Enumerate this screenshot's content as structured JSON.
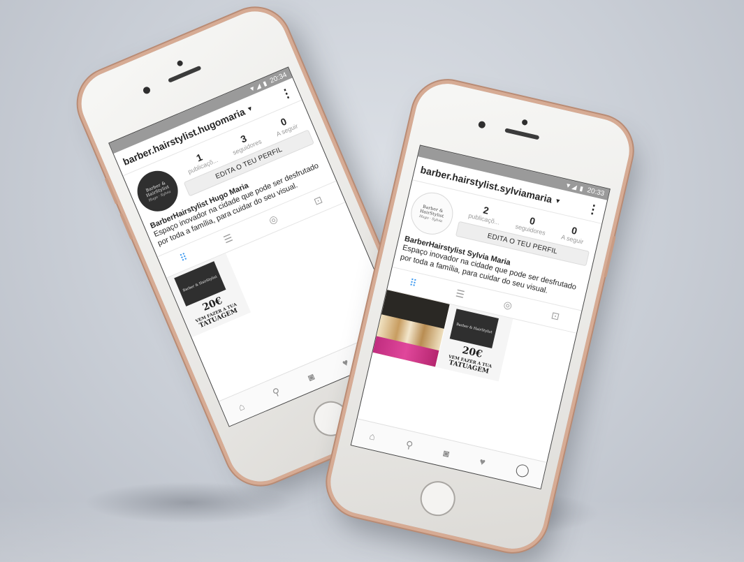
{
  "phones": [
    {
      "status": {
        "time": "20:34",
        "signal": "▼◢ ▮"
      },
      "username": "barber.hairstylist.hugomaria",
      "avatar": {
        "brand": "Barber & HairStylist",
        "sub": "Hugo · Sylvia"
      },
      "stats": [
        {
          "num": "1",
          "label": "publicaçõ..."
        },
        {
          "num": "3",
          "label": "seguidores"
        },
        {
          "num": "0",
          "label": "A seguir"
        }
      ],
      "edit_label": "EDITA O TEU PERFIL",
      "bio_name": "BarberHairstylist Hugo Maria",
      "bio_text": "Espaço inovador na cidade que pode ser desfrutado por toda a família, para cuidar do seu visual.",
      "promo": {
        "brand": "Barber & HairStylist",
        "price": "20€",
        "line1": "VEM FAZER A TUA",
        "line2": "TATUAGEM"
      }
    },
    {
      "status": {
        "time": "20:33",
        "signal": "▼◢ ▮"
      },
      "username": "barber.hairstylist.sylviamaria",
      "avatar": {
        "brand": "Barber & HairStylist",
        "sub": "Hugo · Sylvia"
      },
      "stats": [
        {
          "num": "2",
          "label": "publicaçõ..."
        },
        {
          "num": "0",
          "label": "seguidores"
        },
        {
          "num": "0",
          "label": "A seguir"
        }
      ],
      "edit_label": "EDITA O TEU PERFIL",
      "bio_name": "BarberHairstylist Sylvia Maria",
      "bio_text": "Espaço inovador na cidade que pode ser desfrutado por toda a família, para cuidar do seu visual.",
      "promo": {
        "brand": "Barber & HairStylist",
        "price": "20€",
        "line1": "VEM FAZER A TUA",
        "line2": "TATUAGEM"
      }
    }
  ],
  "icons": {
    "menu": "⋮",
    "caret": "▼",
    "grid": "⠿",
    "list": "☰",
    "location": "◎",
    "tagged": "⊡",
    "home": "⌂",
    "search": "⚲",
    "camera": "◙",
    "heart": "♥"
  },
  "colors": {
    "accent": "#3897f0",
    "phone_rim": "#d6ab94",
    "background": "#c9ced6"
  }
}
